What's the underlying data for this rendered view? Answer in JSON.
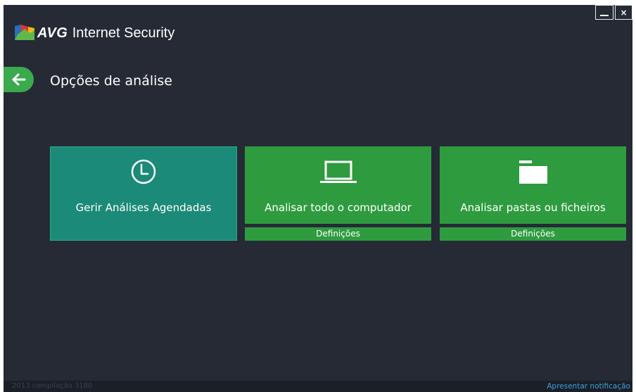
{
  "window": {
    "app_brand": "AVG",
    "app_product": "Internet Security",
    "min_icon": "minimize-icon",
    "close_icon": "close-icon",
    "close_glyph": "×"
  },
  "header": {
    "back_icon": "arrow-left-icon",
    "page_title": "Opções de análise"
  },
  "tiles": [
    {
      "id": "schedules",
      "icon": "clock-icon",
      "label": "Gerir Análises Agendadas",
      "color": "#1c8a78"
    },
    {
      "id": "computer",
      "icon": "laptop-icon",
      "label": "Analisar todo o computador",
      "color": "#2e9b3f",
      "settings_label": "Definições"
    },
    {
      "id": "folders",
      "icon": "folder-icon",
      "label": "Analisar pastas ou ficheiros",
      "color": "#2e9b3f",
      "settings_label": "Definições"
    }
  ],
  "footer": {
    "build": "2013  compilação 3180",
    "notification_link": "Apresentar notificação"
  },
  "colors": {
    "background": "#252a35",
    "accent_green": "#3aaa4c",
    "tile_green": "#2e9b3f",
    "tile_teal": "#1c8a78",
    "link_blue": "#3aa0d8"
  }
}
